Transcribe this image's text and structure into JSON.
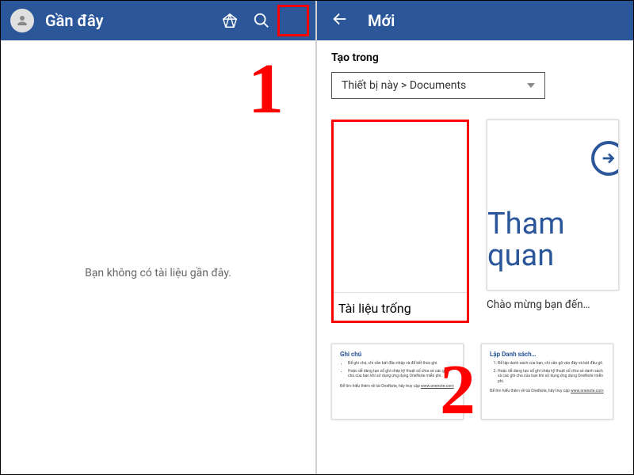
{
  "left": {
    "title": "Gần đây",
    "empty_message": "Bạn không có tài liệu gần đây.",
    "callout": "1"
  },
  "right": {
    "title": "Mới",
    "create_in_label": "Tạo trong",
    "location": "Thiết bị này > Documents",
    "templates": {
      "blank": "Tài liệu trống",
      "welcome_caption": "Chào mừng bạn đến…",
      "welcome_preview": "Tham quan",
      "notes_title": "Ghi chú",
      "list_title": "Lập Danh sách…"
    },
    "callout": "2"
  }
}
